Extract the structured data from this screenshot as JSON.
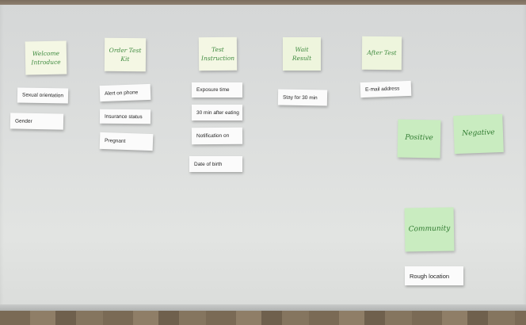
{
  "stickies": [
    {
      "key": "welcome",
      "text": "Welcome Introduce"
    },
    {
      "key": "order",
      "text": "Order Test Kit"
    },
    {
      "key": "test",
      "text": "Test Instruction"
    },
    {
      "key": "wait",
      "text": "Wait Result"
    },
    {
      "key": "after",
      "text": "After Test"
    },
    {
      "key": "positive",
      "text": "Positive"
    },
    {
      "key": "negative",
      "text": "Negative"
    },
    {
      "key": "community",
      "text": "Community"
    }
  ],
  "cards": [
    {
      "key": "sexual",
      "text": "Sexual orientation"
    },
    {
      "key": "gender",
      "text": "Gender"
    },
    {
      "key": "alert",
      "text": "Alert on phone"
    },
    {
      "key": "insurance",
      "text": "Insurance status"
    },
    {
      "key": "pregnant",
      "text": "Pregnant"
    },
    {
      "key": "exposure",
      "text": "Exposure time"
    },
    {
      "key": "eating",
      "text": "30 min after eating"
    },
    {
      "key": "notification",
      "text": "Notification on"
    },
    {
      "key": "dob",
      "text": "Date of birth"
    },
    {
      "key": "stay",
      "text": "Stay for 30 min"
    },
    {
      "key": "email",
      "text": "E-mail address"
    },
    {
      "key": "rough",
      "text": "Rough location"
    }
  ]
}
